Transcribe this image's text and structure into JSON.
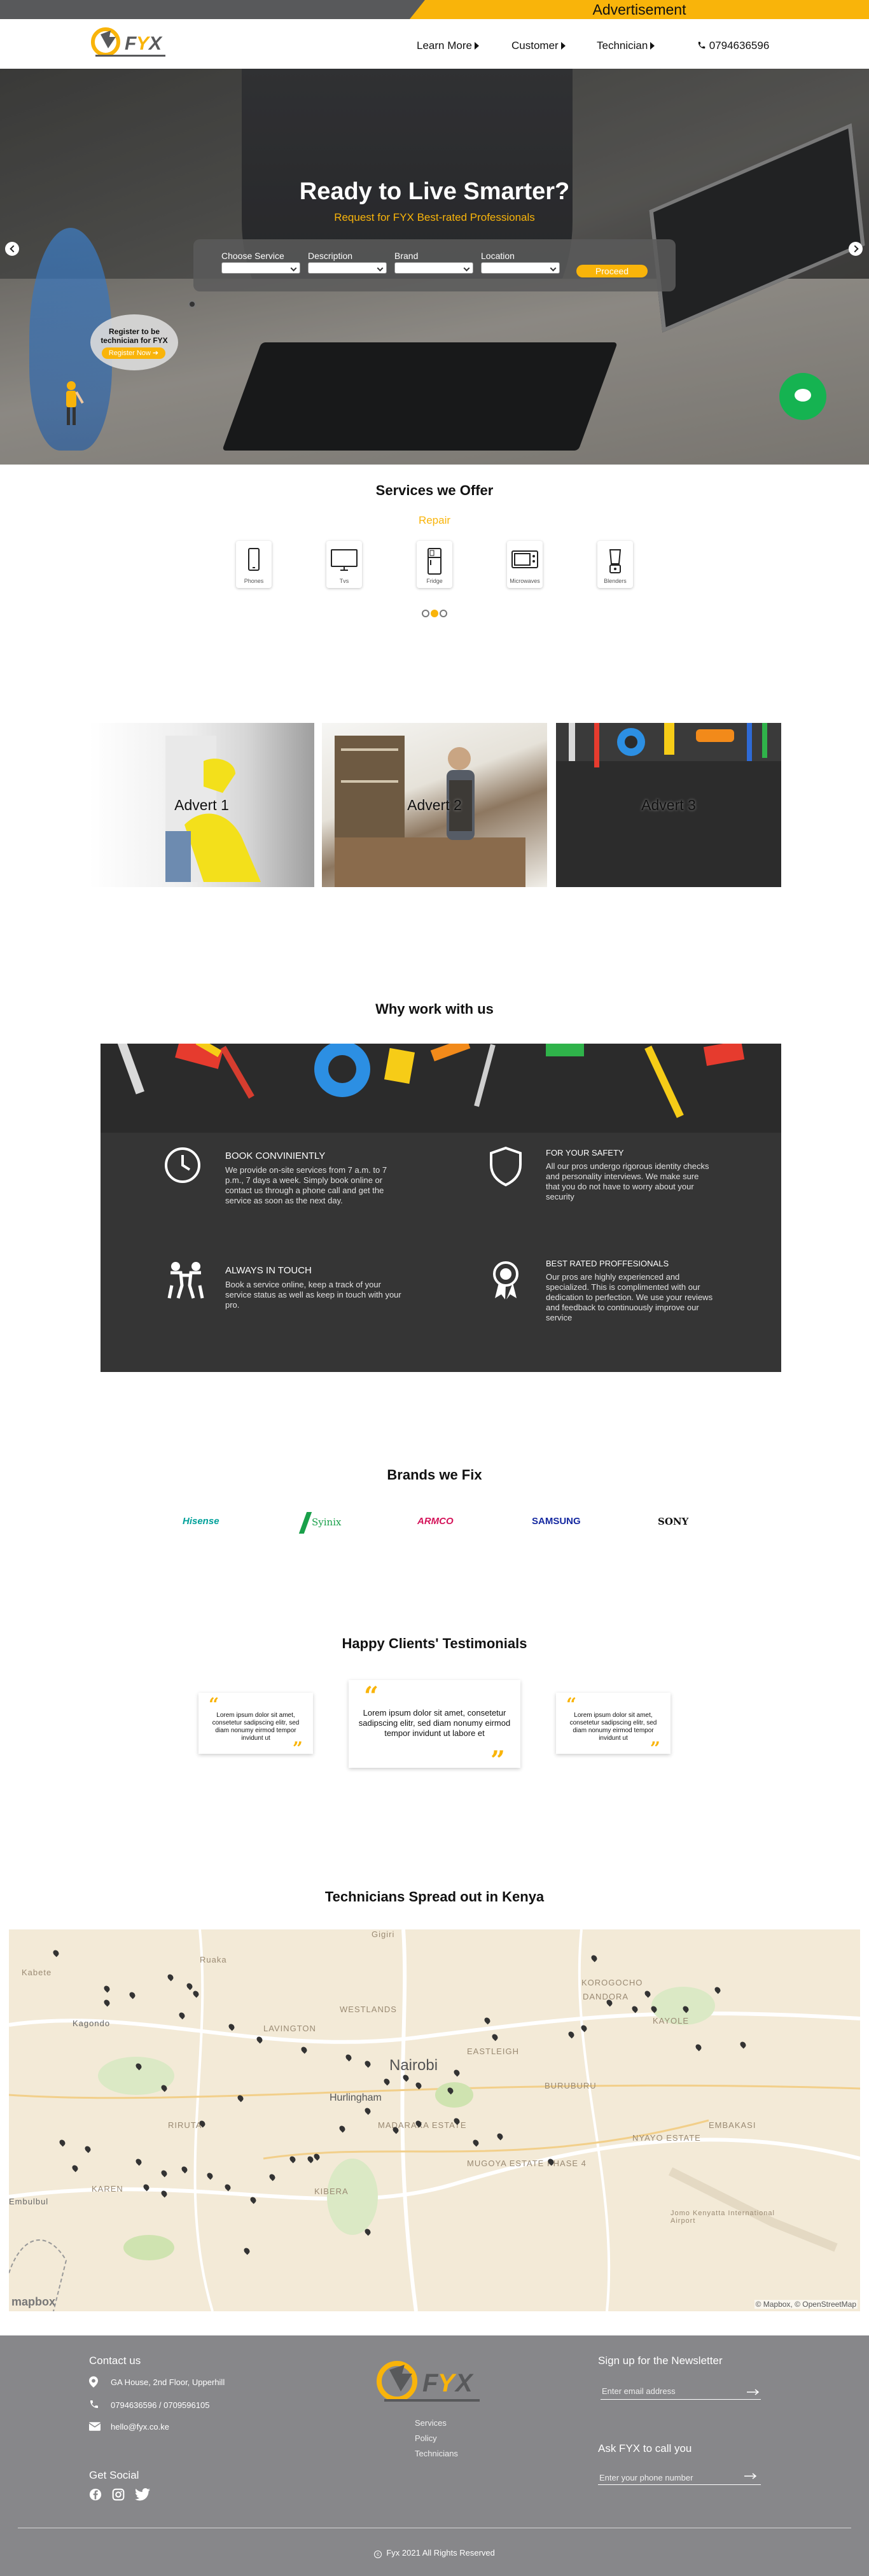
{
  "ad_bar": {
    "text": "Advertisement"
  },
  "header": {
    "nav": [
      "Learn More",
      "Customer",
      "Technician"
    ],
    "phone": "0794636596"
  },
  "hero": {
    "title": "Ready to Live Smarter?",
    "subtitle": "Request for FYX Best-rated Professionals",
    "fields": [
      {
        "label": "Choose Service",
        "value": ""
      },
      {
        "label": "Description",
        "value": ""
      },
      {
        "label": "Brand",
        "value": ""
      },
      {
        "label": "Location",
        "value": ""
      }
    ],
    "proceed": "Proceed",
    "register_text": "Register to be technician for FYX",
    "register_button": "Register Now"
  },
  "services": {
    "title": "Services we Offer",
    "category": "Repair",
    "items": [
      "Phones",
      "Tvs",
      "Fridge",
      "Microwaves",
      "Blenders"
    ]
  },
  "adverts": [
    "Advert 1",
    "Advert 2",
    "Advert 3"
  ],
  "why": {
    "title": "Why work with us",
    "items": [
      {
        "heading": "BOOK CONVINIENTLY",
        "text": "We provide on-site services from 7 a.m. to 7 p.m., 7 days a week. Simply book online or contact us through a phone call and get the service as soon as the next day.",
        "icon": "clock-icon"
      },
      {
        "heading": "FOR YOUR SAFETY",
        "text": "All our pros undergo rigorous identity checks and personality interviews. We make sure that you do not have to worry about your security",
        "icon": "shield-icon"
      },
      {
        "heading": "ALWAYS IN TOUCH",
        "text": "Book a service online, keep a track of your service status as well as keep in touch with your pro.",
        "icon": "people-icon"
      },
      {
        "heading": "BEST RATED PROFFESIONALS",
        "text": "Our pros are highly experienced and specialized. This is complimented with our dedication to perfection. We use your reviews and feedback to continuously improve our service",
        "icon": "award-icon"
      }
    ]
  },
  "brands": {
    "title": "Brands we Fix",
    "items": [
      {
        "name": "Hisense",
        "color": "#00a19a"
      },
      {
        "name": "Syinix",
        "color": "#19a04a"
      },
      {
        "name": "ARMCO",
        "color": "#d4145a"
      },
      {
        "name": "SAMSUNG",
        "color": "#1428a0"
      },
      {
        "name": "SONY",
        "color": "#111111"
      }
    ]
  },
  "testimonials": {
    "title": "Happy Clients' Testimonials",
    "items": [
      "Lorem ipsum dolor sit amet, consetetur sadipscing elitr, sed diam nonumy eirmod tempor invidunt ut",
      "Lorem ipsum dolor sit amet, consetetur sadipscing elitr, sed diam nonumy eirmod tempor invidunt ut labore et",
      "Lorem ipsum dolor sit amet, consetetur sadipscing elitr, sed diam nonumy eirmod tempor invidunt ut"
    ]
  },
  "map": {
    "title": "Technicians Spread out in Kenya",
    "labels": [
      "Nairobi",
      "Hurlingham",
      "KAREN",
      "KIBERA",
      "LAVINGTON",
      "WESTLANDS",
      "EASTLEIGH",
      "KOROGOCHO",
      "DANDORA",
      "KAYOLE",
      "EMBAKASI",
      "NYAYO ESTATE",
      "MADARAKA ESTATE",
      "MUGOYA ESTATE PHASE 4",
      "RIRUTA",
      "Kabete",
      "Ruaka",
      "Kagondo",
      "Gigiri",
      "Embulbul",
      "Jomo Kenyatta International Airport",
      "BURUBURU"
    ],
    "attribution": "© Mapbox, © OpenStreetMap",
    "mapbox_logo": "mapbox"
  },
  "footer": {
    "contact_title": "Contact us",
    "address": "GA House, 2nd Floor, Upperhill",
    "phones": "0794636596 / 0709596105",
    "email": "hello@fyx.co.ke",
    "social_title": "Get Social",
    "links": [
      "Services",
      "Policy",
      "Technicians"
    ],
    "newsletter_title": "Sign up for the Newsletter",
    "newsletter_placeholder": "Enter email address",
    "call_title": "Ask FYX to call you",
    "call_placeholder": "Enter your phone number",
    "copyright": "Fyx 2021 All Rights Reserved"
  },
  "colors": {
    "accent": "#f9b40a",
    "dark": "#58595b",
    "footer": "#87878a",
    "chat": "#15b351"
  }
}
